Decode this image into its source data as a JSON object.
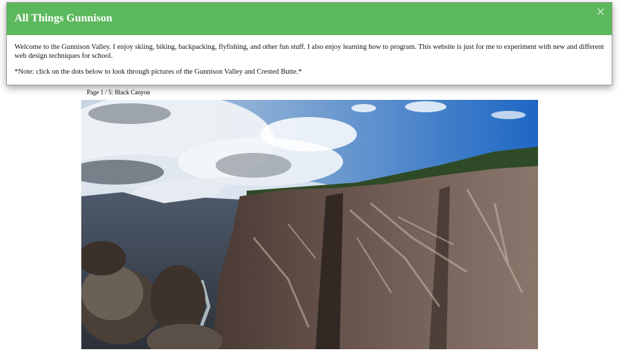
{
  "modal": {
    "title": "All Things Gunnison",
    "close_symbol": "×",
    "intro": "Welcome to the Gunnison Valley. I enjoy skiing, biking, backpacking, flyfishing, and other fun stuff. I also enjoy learning how to program. This website is just for me to experiment with new and different web design techniques for school.",
    "note": "*Note: click on the dots below to look through pictures of the Gunnison Valley and Crested Butte.*",
    "header_color": "#5cb85c"
  },
  "slideshow": {
    "caption": "Page 1 / 5: Black Canyon",
    "image_subject": "black-canyon-photo"
  }
}
